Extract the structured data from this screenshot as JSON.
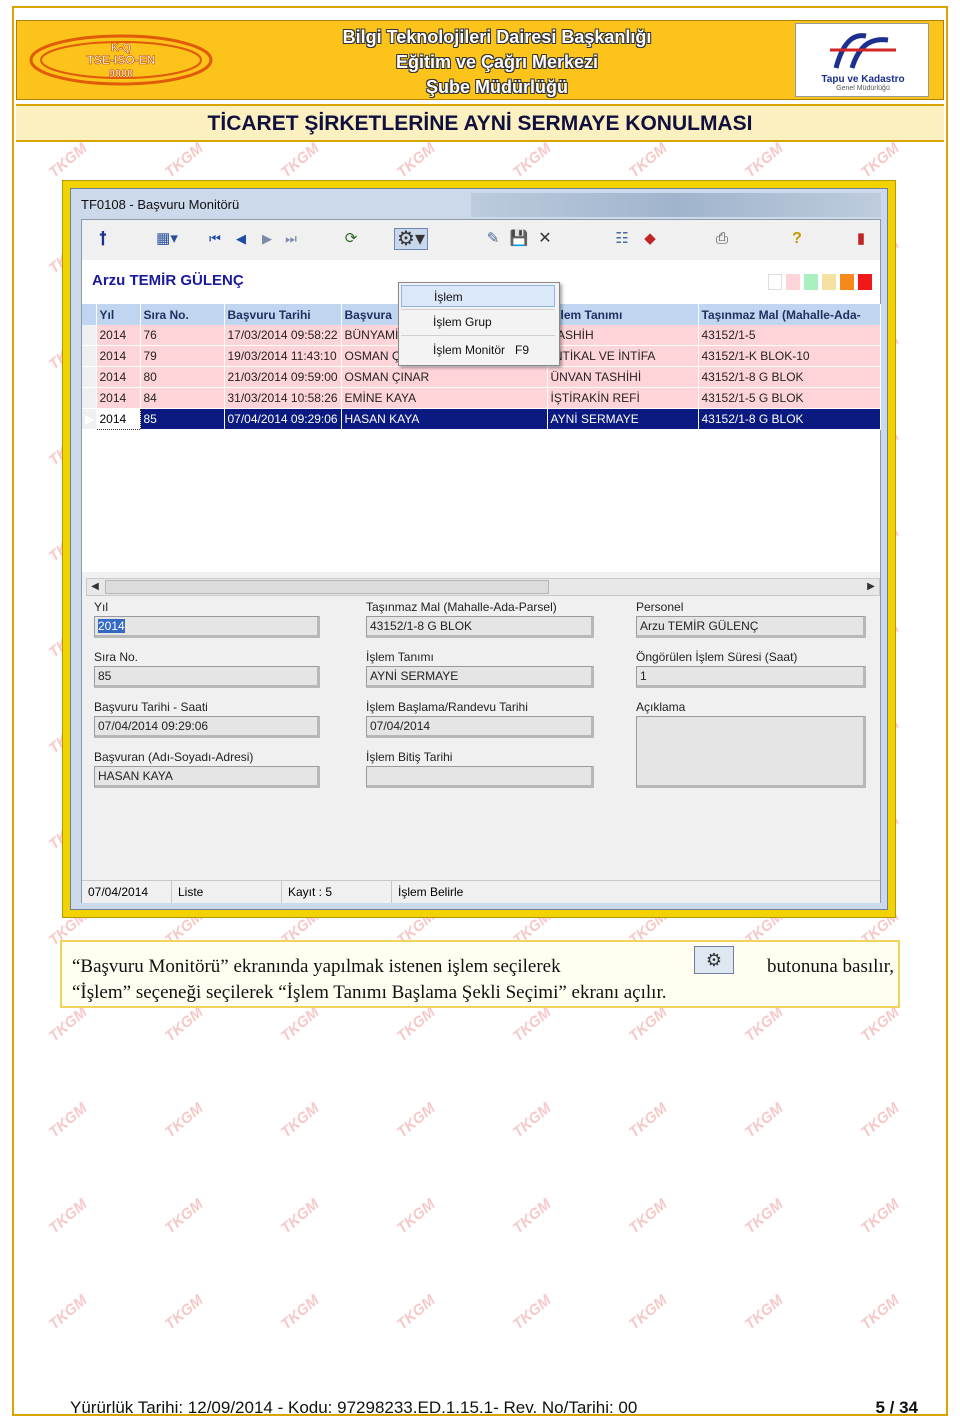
{
  "header": {
    "logo_lines": [
      "K-Q",
      "TSE-ISO-EN",
      "9000"
    ],
    "lines": [
      "Bilgi Teknolojileri Dairesi Başkanlığı",
      "Eğitim ve Çağrı Merkezi",
      "Şube Müdürlüğü"
    ],
    "tk_logo_text": "Tapu ve Kadastro",
    "tk_logo_sub": "Genel Müdürlüğü"
  },
  "doc_title": "TİCARET ŞİRKETLERİNE AYNİ SERMAYE KONULMASI",
  "watermark_text": "TKGM",
  "window": {
    "title": "TF0108 - Başvuru Monitörü",
    "user": "Arzu TEMİR GÜLENÇ",
    "swatch_colors": [
      "#ffffff",
      "#ffd4d9",
      "#a8f0c0",
      "#f6e2a0",
      "#f58a1a",
      "#f01818"
    ],
    "menu": {
      "items": [
        {
          "label": "İşlem",
          "key": ""
        },
        {
          "label": "İşlem Grup",
          "key": ""
        },
        {
          "label": "İşlem Monitör",
          "key": "F9"
        }
      ]
    },
    "grid": {
      "columns": [
        "Yıl",
        "Sıra No.",
        "Başvuru Tarihi",
        "Başvura",
        "İşlem Tanımı",
        "Taşınmaz Mal (Mahalle-Ada-"
      ],
      "rows": [
        {
          "yil": "2014",
          "sira": "76",
          "tarih": "17/03/2014 09:58:22",
          "basvuran": "BÜNYAMİN OKKALI",
          "islem": "TASHİH",
          "tasinmaz": "43152/1-5"
        },
        {
          "yil": "2014",
          "sira": "79",
          "tarih": "19/03/2014 11:43:10",
          "basvuran": "OSMAN ÇINAR",
          "islem": "İNTİKAL VE İNTİFA",
          "tasinmaz": "43152/1-K BLOK-10"
        },
        {
          "yil": "2014",
          "sira": "80",
          "tarih": "21/03/2014 09:59:00",
          "basvuran": "OSMAN ÇINAR",
          "islem": "ÜNVAN TASHİHİ",
          "tasinmaz": "43152/1-8 G BLOK"
        },
        {
          "yil": "2014",
          "sira": "84",
          "tarih": "31/03/2014 10:58:26",
          "basvuran": "EMİNE KAYA",
          "islem": "İŞTİRAKİN REFİ",
          "tasinmaz": "43152/1-5 G BLOK"
        },
        {
          "yil": "2014",
          "sira": "85",
          "tarih": "07/04/2014 09:29:06",
          "basvuran": "HASAN KAYA",
          "islem": "AYNİ SERMAYE",
          "tasinmaz": "43152/1-8 G BLOK"
        }
      ]
    },
    "details": {
      "yil_label": "Yıl",
      "yil": "2014",
      "sira_label": "Sıra No.",
      "sira": "85",
      "tarih_label": "Başvuru Tarihi - Saati",
      "tarih": "07/04/2014 09:29:06",
      "basvuran_label": "Başvuran (Adı-Soyadı-Adresi)",
      "basvuran": "HASAN KAYA",
      "tasinmaz_label": "Taşınmaz Mal (Mahalle-Ada-Parsel)",
      "tasinmaz": "43152/1-8 G BLOK",
      "islem_tanimi_label": "İşlem Tanımı",
      "islem_tanimi": "AYNİ SERMAYE",
      "baslama_label": "İşlem Başlama/Randevu Tarihi",
      "baslama": "07/04/2014",
      "bitis_label": "İşlem Bitiş Tarihi",
      "bitis": "",
      "personel_label": "Personel",
      "personel": "Arzu TEMİR GÜLENÇ",
      "sure_label": "Öngörülen İşlem Süresi (Saat)",
      "sure": "1",
      "aciklama_label": "Açıklama",
      "aciklama": ""
    },
    "status": {
      "date": "07/04/2014",
      "mode": "Liste",
      "kayit": "Kayıt : 5",
      "message": "İşlem Belirle"
    }
  },
  "caption": {
    "part1": "“Başvuru Monitörü” ekranında yapılmak istenen işlem seçilerek",
    "part2": "butonuna basılır,",
    "line2": "“İşlem” seçeneği seçilerek “İşlem Tanımı Başlama Şekli Seçimi” ekranı açılır."
  },
  "footer": {
    "text": "Yürürlük Tarihi: 12/09/2014  -  Kodu: 97298233.ED.1.15.1-  Rev. No/Tarihi: 00",
    "page": "5 / 34"
  }
}
